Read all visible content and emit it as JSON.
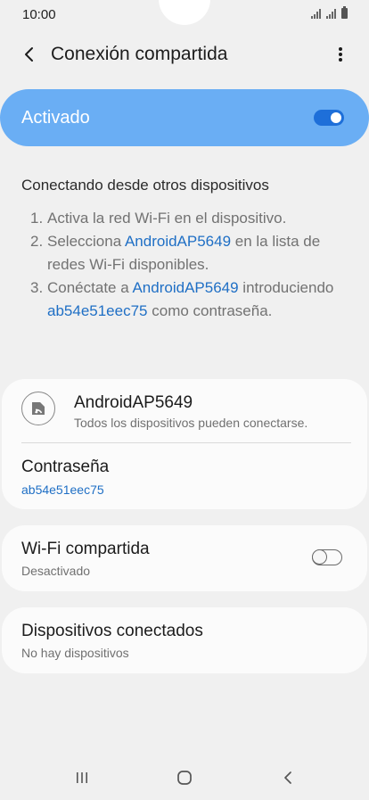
{
  "status_bar": {
    "time": "10:00",
    "icons": [
      "wifi-signal-icon",
      "cell-signal-icon",
      "battery-icon"
    ]
  },
  "header": {
    "title": "Conexión compartida",
    "back_icon": "back-arrow-icon",
    "more_icon": "more-vert-icon"
  },
  "master_switch": {
    "label": "Activado",
    "state": "on"
  },
  "instructions": {
    "title": "Conectando desde otros dispositivos",
    "steps": [
      {
        "num": "1.",
        "text": "Activa la red Wi-Fi en el dispositivo."
      },
      {
        "num": "2.",
        "pre": "Selecciona ",
        "highlight": "AndroidAP5649",
        "post": " en la lista de redes Wi-Fi disponibles."
      },
      {
        "num": "3.",
        "pre": "Conéctate a ",
        "highlight": "AndroidAP5649",
        "mid": " introduciendo ",
        "highlight2": "ab54e51eec75",
        "post": " como contraseña."
      }
    ]
  },
  "network_card": {
    "name": "AndroidAP5649",
    "subtitle": "Todos los dispositivos pueden conectarse.",
    "password_label": "Contraseña",
    "password_value": "ab54e51eec75"
  },
  "wifi_share": {
    "title": "Wi-Fi compartida",
    "subtitle": "Desactivado",
    "state": "off"
  },
  "connected_devices": {
    "title": "Dispositivos conectados",
    "subtitle": "No hay dispositivos"
  },
  "nav_bar": {
    "icons": [
      "recents-icon",
      "home-icon",
      "back-nav-icon"
    ]
  },
  "colors": {
    "accent": "#1f6fc5",
    "switch_bg": "#6aaef4",
    "toggle_on": "#1e6fd9"
  }
}
